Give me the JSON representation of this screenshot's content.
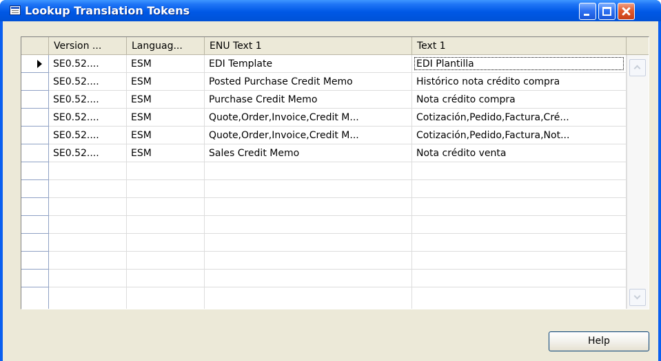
{
  "window": {
    "title": "Lookup Translation Tokens"
  },
  "grid": {
    "columns": [
      {
        "label": "Version ..."
      },
      {
        "label": "Languag..."
      },
      {
        "label": "ENU Text 1"
      },
      {
        "label": "Text 1"
      }
    ],
    "rows": [
      [
        "SE0.52....",
        "ESM",
        "EDI Template",
        "EDI Plantilla"
      ],
      [
        "SE0.52....",
        "ESM",
        "Posted Purchase Credit Memo",
        "Histórico nota crédito compra"
      ],
      [
        "SE0.52....",
        "ESM",
        "Purchase Credit Memo",
        "Nota crédito compra"
      ],
      [
        "SE0.52....",
        "ESM",
        "Quote,Order,Invoice,Credit M...",
        "Cotización,Pedido,Factura,Cré..."
      ],
      [
        "SE0.52....",
        "ESM",
        "Quote,Order,Invoice,Credit M...",
        "Cotización,Pedido,Factura,Not..."
      ],
      [
        "SE0.52....",
        "ESM",
        "Sales Credit Memo",
        "Nota crédito venta"
      ]
    ],
    "empty_rows": 5
  },
  "buttons": {
    "help_label": "Help"
  }
}
